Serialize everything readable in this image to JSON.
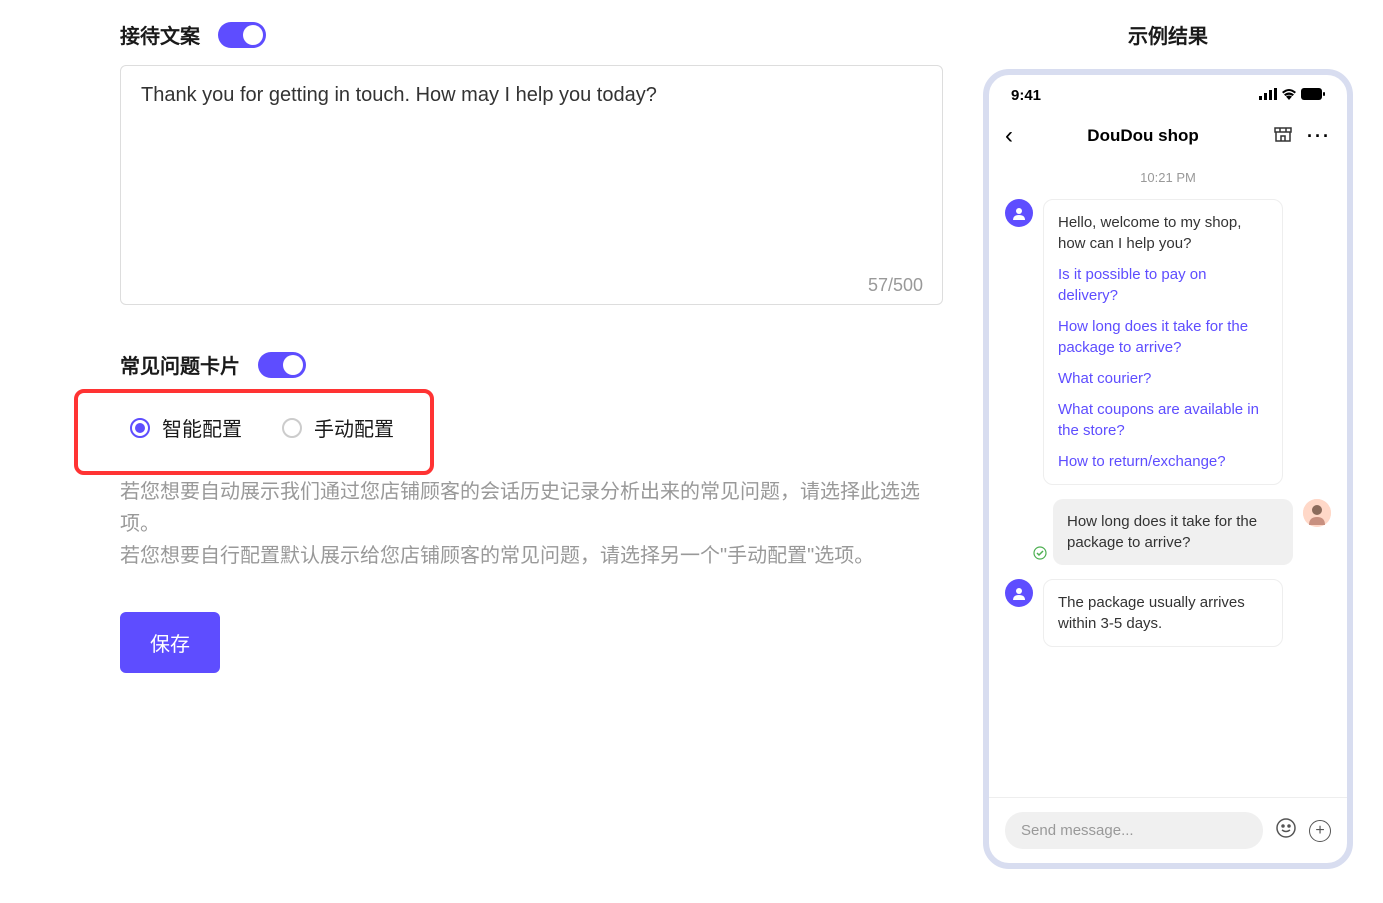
{
  "greeting": {
    "title": "接待文案",
    "text": "Thank you for getting in touch. How may I help you today?",
    "counter": "57/500"
  },
  "faq": {
    "title": "常见问题卡片",
    "radio_smart": "智能配置",
    "radio_manual": "手动配置",
    "description_line1": "若您想要自动展示我们通过您店铺顾客的会话历史记录分析出来的常见问题，请选择此选选项。",
    "description_line2": "若您想要自行配置默认展示给您店铺顾客的常见问题，请选择另一个\"手动配置\"选项。"
  },
  "save_button": "保存",
  "preview": {
    "title": "示例结果",
    "status_time": "9:41",
    "shop_name": "DouDou shop",
    "chat_time": "10:21 PM",
    "welcome_msg": "Hello, welcome to my shop, how can I help you?",
    "faq_links": [
      "Is it possible to pay on delivery?",
      "How long does it take for the package to arrive?",
      "What courier?",
      "What coupons are available in the store?",
      "How to return/exchange?"
    ],
    "user_question": "How long does it take for the package to arrive?",
    "bot_answer": "The package usually arrives within 3-5 days.",
    "input_placeholder": "Send message..."
  }
}
